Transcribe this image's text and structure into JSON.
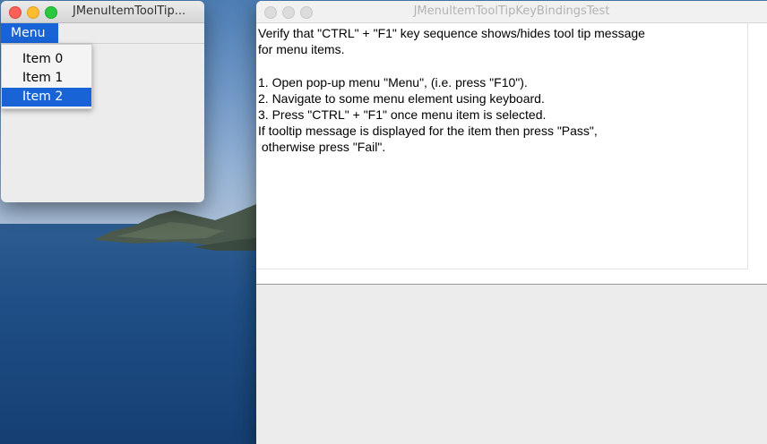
{
  "left_window": {
    "title": "JMenuItemToolTip...",
    "menu": {
      "label": "Menu"
    },
    "popup_items": [
      "Item 0",
      "Item 1",
      "Item 2"
    ],
    "selected_index": 2
  },
  "right_window": {
    "title": "JMenuItemToolTipKeyBindingsTest",
    "instructions": "Verify that \"CTRL\" + \"F1\" key sequence shows/hides tool tip message\nfor menu items.\n\n1. Open pop-up menu \"Menu\", (i.e. press \"F10\").\n2. Navigate to some menu element using keyboard.\n3. Press \"CTRL\" + \"F1\" once menu item is selected.\nIf tooltip message is displayed for the item then press \"Pass\",\n otherwise press \"Fail\"."
  },
  "colors": {
    "selection": "#1863d6",
    "close": "#fe5f57",
    "minimize": "#febc2e",
    "zoom": "#28c840"
  },
  "icons": [
    "close-button",
    "minimize-button",
    "zoom-button"
  ]
}
